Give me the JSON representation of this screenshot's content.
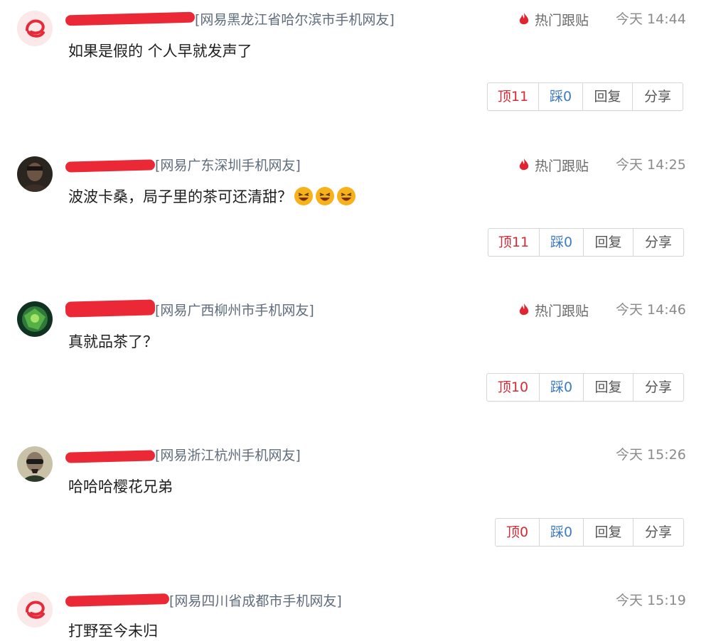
{
  "comments": [
    {
      "source": "[网易黑龙江省哈尔滨市手机网友]",
      "hot_label": "热门跟贴",
      "time": "今天 14:44",
      "content": "如果是假的 个人早就发声了",
      "up": "顶11",
      "down": "踩0",
      "reply": "回复",
      "share": "分享",
      "avatar": "netease-logo-icon"
    },
    {
      "source": "[网易广东深圳手机网友]",
      "hot_label": "热门跟贴",
      "time": "今天 14:25",
      "content": "波波卡桑，局子里的茶可还清甜？",
      "up": "顶11",
      "down": "踩0",
      "reply": "回复",
      "share": "分享",
      "avatar": "user-photo-avatar",
      "emojis": [
        "laughing-emoji-icon",
        "laughing-emoji-icon",
        "laughing-emoji-icon"
      ]
    },
    {
      "source": "[网易广西柳州市手机网友]",
      "hot_label": "热门跟贴",
      "time": "今天 14:46",
      "content": "真就品茶了？",
      "up": "顶10",
      "down": "踩0",
      "reply": "回复",
      "share": "分享",
      "avatar": "user-photo-avatar"
    },
    {
      "source": "[网易浙江杭州手机网友]",
      "time": "今天 15:26",
      "content": "哈哈哈樱花兄弟",
      "up": "顶0",
      "down": "踩0",
      "reply": "回复",
      "share": "分享",
      "avatar": "user-photo-avatar"
    },
    {
      "source": "[网易四川省成都市手机网友]",
      "time": "今天 15:19",
      "content": "打野至今未归",
      "avatar": "netease-logo-icon"
    }
  ],
  "colors": {
    "accent_red": "#d32a36",
    "link_blue": "#3f7bc0",
    "redaction": "#ea1c2a"
  }
}
